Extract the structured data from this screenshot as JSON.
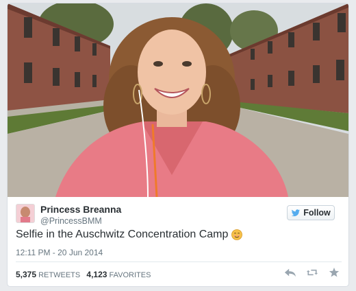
{
  "tweet": {
    "author_name": "Princess Breanna",
    "author_handle": "@PrincessBMM",
    "text": "Selfie in the Auschwitz Concentration Camp",
    "emoji": "smiling-face-emoji",
    "timestamp": "12:11 PM - 20 Jun 2014",
    "retweets": "5,375",
    "retweets_label": "RETWEETS",
    "favorites": "4,123",
    "favorites_label": "FAVORITES"
  },
  "follow_button": {
    "label": "Follow",
    "icon": "twitter-bird-icon"
  },
  "actions": [
    {
      "name": "reply-icon"
    },
    {
      "name": "retweet-icon"
    },
    {
      "name": "favorite-star-icon"
    }
  ],
  "colors": {
    "accent": "#55acee",
    "text": "#292f33",
    "muted": "#66757f",
    "sweater": "#e87b86"
  }
}
